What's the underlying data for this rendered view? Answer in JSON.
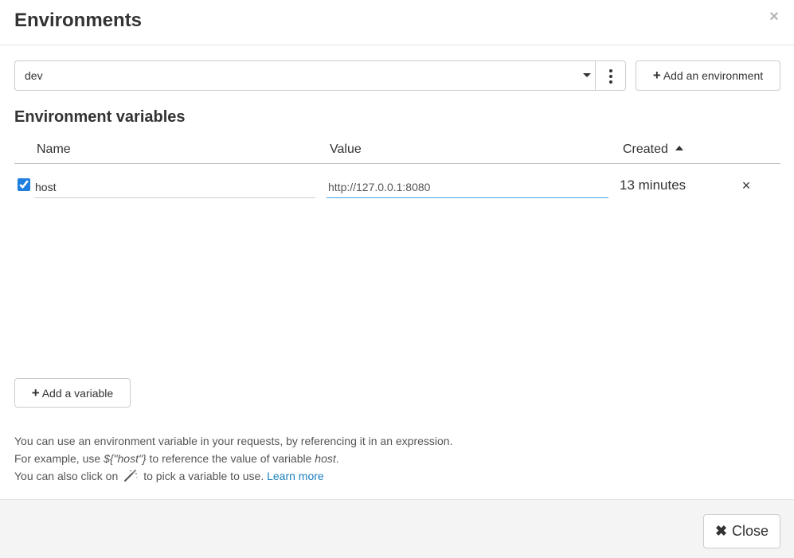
{
  "modal": {
    "title": "Environments",
    "close_glyph": "×"
  },
  "environment_select": {
    "selected": "dev",
    "add_label": "Add an environment"
  },
  "variables": {
    "section_title": "Environment variables",
    "columns": {
      "name": "Name",
      "value": "Value",
      "created": "Created"
    },
    "sort": {
      "column": "created",
      "direction": "ascending"
    },
    "rows": [
      {
        "enabled": true,
        "name": "host",
        "value": "http://127.0.0.1:8080",
        "created": "13 minutes"
      }
    ],
    "delete_glyph": "×",
    "add_label": "Add a variable"
  },
  "help": {
    "line1": "You can use an environment variable in your requests, by referencing it in an expression.",
    "line2_prefix": "For example, use ",
    "line2_code": "${\"host\"}",
    "line2_middle": " to reference the value of variable ",
    "line2_var": "host",
    "line2_suffix": ".",
    "line3_prefix": "You can also click on",
    "line3_middle": "to pick a variable to use.",
    "learn_more": "Learn more"
  },
  "footer": {
    "close_label": "Close",
    "close_glyph": "✖"
  },
  "icons": {
    "plus": "plus-icon",
    "kebab": "vertical-ellipsis-icon",
    "caret": "caret-down-icon",
    "sort": "sort-ascending-icon",
    "wand": "magic-wand-icon",
    "close": "close-icon"
  },
  "colors": {
    "accent": "#1e7fe0",
    "link": "#1a7fbf",
    "focus_underline": "#4aa3df"
  }
}
